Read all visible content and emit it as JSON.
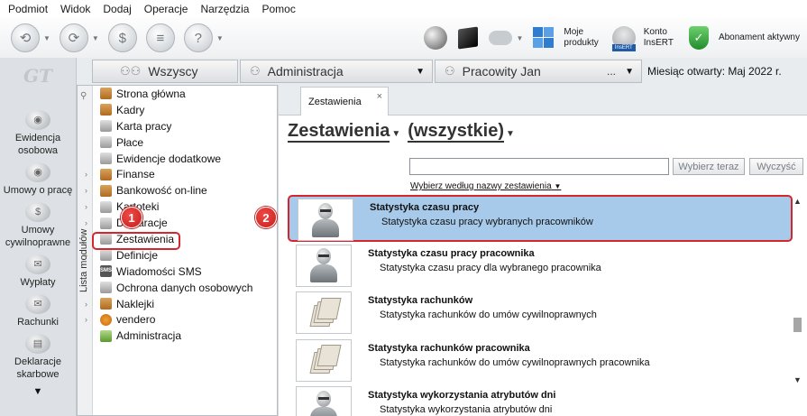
{
  "menu": [
    "Podmiot",
    "Widok",
    "Dodaj",
    "Operacje",
    "Narzędzia",
    "Pomoc"
  ],
  "toolbar": {
    "moje_produkty_1": "Moje",
    "moje_produkty_2": "produkty",
    "konto_1": "Konto",
    "konto_2": "InsERT",
    "insert_badge": "InsERT",
    "abonament": "Abonament aktywny"
  },
  "logo": "GT",
  "leftbar": [
    {
      "label": "Ewidencja osobowa",
      "icon": "people-icon"
    },
    {
      "label": "Umowy o pracę",
      "icon": "contract-icon"
    },
    {
      "label": "Umowy cywilnoprawne",
      "icon": "civil-contract-icon"
    },
    {
      "label": "Wypłaty",
      "icon": "payout-icon"
    },
    {
      "label": "Rachunki",
      "icon": "bills-icon"
    },
    {
      "label": "Deklaracje skarbowe",
      "icon": "tax-declaration-icon"
    }
  ],
  "tabs": {
    "wszyscy": "Wszyscy",
    "administracja": "Administracja",
    "pracowity": "Pracowity Jan",
    "pracowity_dots": "...",
    "month": "Miesiąc otwarty:  Maj 2022 r."
  },
  "modules": {
    "vertical_label": "Lista modułów",
    "items": [
      {
        "label": "Strona główna",
        "expandable": false
      },
      {
        "label": "Kadry",
        "expandable": false
      },
      {
        "label": "Karta pracy",
        "expandable": false
      },
      {
        "label": "Płace",
        "expandable": false
      },
      {
        "label": "Ewidencje dodatkowe",
        "expandable": false
      },
      {
        "label": "Finanse",
        "expandable": true
      },
      {
        "label": "Bankowość on-line",
        "expandable": true
      },
      {
        "label": "Kartoteki",
        "expandable": true
      },
      {
        "label": "Deklaracje",
        "expandable": true
      },
      {
        "label": "Zestawienia",
        "expandable": false
      },
      {
        "label": "Definicje",
        "expandable": true
      },
      {
        "label": "Wiadomości SMS",
        "expandable": false
      },
      {
        "label": "Ochrona danych osobowych",
        "expandable": true
      },
      {
        "label": "Naklejki",
        "expandable": true
      },
      {
        "label": "vendero",
        "expandable": true
      },
      {
        "label": "Administracja",
        "expandable": false
      }
    ]
  },
  "badges": {
    "one": "1",
    "two": "2"
  },
  "content": {
    "tab_label": "Zestawienia",
    "tab_close": "×",
    "heading_main": "Zestawienia",
    "heading_filter": "(wszystkie)",
    "search_value": "",
    "search_button": "Wybierz teraz",
    "clear_button": "Wyczyść",
    "filter_link": "Wybierz według nazwy zestawienia",
    "rows": [
      {
        "title": "Statystyka czasu pracy",
        "desc": "Statystyka czasu pracy wybranych pracowników",
        "icon": "person-icon",
        "selected": true
      },
      {
        "title": "Statystyka czasu pracy pracownika",
        "desc": "Statystyka czasu pracy dla wybranego pracownika",
        "icon": "person-icon",
        "selected": false
      },
      {
        "title": "Statystyka rachunków",
        "desc": "Statystyka rachunków do umów cywilnoprawnych",
        "icon": "papers-icon",
        "selected": false
      },
      {
        "title": "Statystyka rachunków pracownika",
        "desc": "Statystyka rachunków do umów cywilnoprawnych pracownika",
        "icon": "papers-icon",
        "selected": false
      },
      {
        "title": "Statystyka wykorzystania atrybutów dni",
        "desc": "Statystyka wykorzystania atrybutów dni",
        "icon": "person-icon",
        "selected": false
      }
    ]
  }
}
